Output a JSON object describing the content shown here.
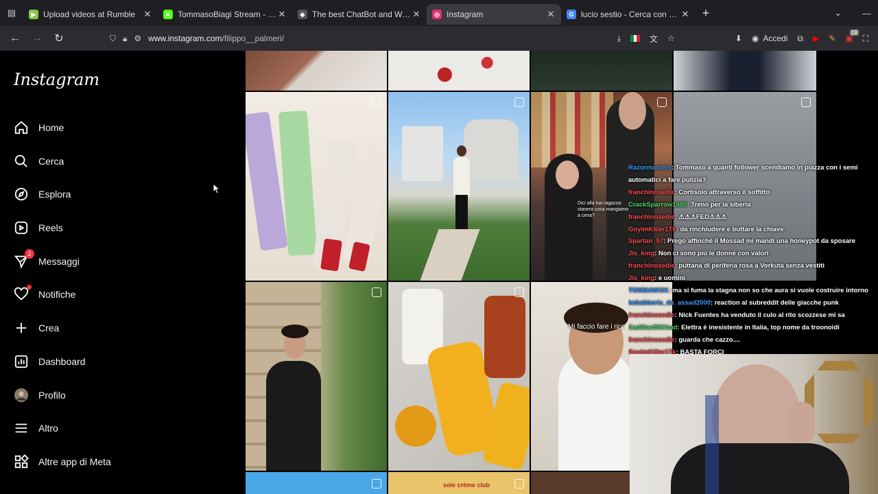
{
  "browser": {
    "tabs": [
      {
        "title": "Upload videos at Rumble",
        "favicon_color": "#85c742",
        "favicon_glyph": "▶",
        "active": false
      },
      {
        "title": "TommasoBiagi Stream - Watch",
        "favicon_color": "#53fc18",
        "favicon_glyph": "K",
        "active": false
      },
      {
        "title": "The best ChatBot and Widgets",
        "favicon_color": "#555555",
        "favicon_glyph": "◆",
        "active": false
      },
      {
        "title": "Instagram",
        "favicon_color": "#e1306c",
        "favicon_glyph": "◎",
        "active": true
      },
      {
        "title": "lucio sestio - Cerca con Google",
        "favicon_color": "#4285f4",
        "favicon_glyph": "G",
        "active": false
      }
    ],
    "url_prefix": "www.instagram.com",
    "url_path": "/filippo__palmeri/",
    "accedi_label": "Accedi",
    "extension_badge": "19"
  },
  "instagram": {
    "logo": "Instagram",
    "nav": [
      {
        "label": "Home",
        "icon": "home-icon"
      },
      {
        "label": "Cerca",
        "icon": "search-icon"
      },
      {
        "label": "Esplora",
        "icon": "compass-icon"
      },
      {
        "label": "Reels",
        "icon": "reels-icon"
      },
      {
        "label": "Messaggi",
        "icon": "messenger-icon",
        "badge": "2"
      },
      {
        "label": "Notifiche",
        "icon": "heart-icon",
        "dot": true
      },
      {
        "label": "Crea",
        "icon": "plus-icon"
      },
      {
        "label": "Dashboard",
        "icon": "dashboard-icon"
      },
      {
        "label": "Profilo",
        "icon": "avatar-icon"
      },
      {
        "label": "Altro",
        "icon": "menu-icon"
      },
      {
        "label": "Altre app di Meta",
        "icon": "meta-apps-icon"
      }
    ],
    "captions": {
      "post7_overlay": "Dici alla tua ragazza: stasera cosa mangiamo a cena?",
      "post10_overlay": "Mi faccio fare i ricc",
      "post11_overlay": "sole crème club"
    }
  },
  "chat": [
    {
      "user": "Razormasters",
      "user_color": "#3a9bff",
      "text": ": Tommaso a quanti follower scendiamo in piazza con i semi automatici a fare pulizia?"
    },
    {
      "user": "franchinosedie",
      "user_color": "#ff4a4a",
      "text": ": Cortisolo attraverso il soffitto"
    },
    {
      "user": "CrackSparrow1488",
      "user_color": "#4cd964",
      "text": ": Treno per la siberia"
    },
    {
      "user": "franchinosedie",
      "user_color": "#ff4a4a",
      "text": ": ⚠⚠⚠FED⚠⚠⚠"
    },
    {
      "user": "GoyimKiller1Tk",
      "user_color": "#ff4a4a",
      "text": ": da rinchiudere e buttare la chiave"
    },
    {
      "user": "Spartan_57",
      "user_color": "#ff4a4a",
      "text": ": Prego affinché il Mossad mi mandi una honeypot da sposare"
    },
    {
      "user": "Jis_king",
      "user_color": "#ff4a4a",
      "text": ": Non ci sono più le donne con valori"
    },
    {
      "user": "franchinosedie",
      "user_color": "#ff4a4a",
      "text": ": puttana di periferia rosa a Vorkuta senza vestiti"
    },
    {
      "user": "Jis_king",
      "user_color": "#ff4a4a",
      "text": ": e uomini"
    },
    {
      "user": "TOMMAWOK",
      "user_color": "#3a9bff",
      "text": ": ma si fuma la stagna non so che aura si vuole costruire intorno"
    },
    {
      "user": "kebabberia_da_assad2000",
      "user_color": "#3a9bff",
      "text": ": reaction al subreddit delle giacche punk"
    },
    {
      "user": "franchinosedie",
      "user_color": "#ff4a4a",
      "text": ": Nick Fuentes ha venduto il culo al rito scozzese mi sa"
    },
    {
      "user": "Cadillac59Chud",
      "user_color": "#4cd964",
      "text": ": Elettra è inesistente in Italia, top nome da troonoidi"
    },
    {
      "user": "franchinosedie",
      "user_color": "#ff4a4a",
      "text": ": guarda che cazzo...."
    },
    {
      "user": "GoyimKiller1Tk",
      "user_color": "#ff4a4a",
      "text": ": BASTA FORCI"
    }
  ]
}
